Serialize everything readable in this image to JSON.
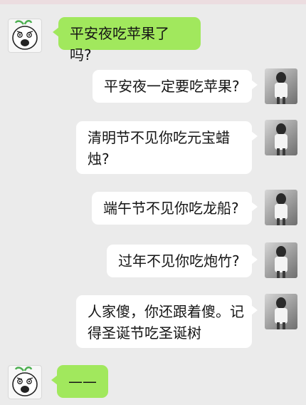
{
  "chat": {
    "messages": [
      {
        "side": "left",
        "text": "平安夜吃苹果了吗?"
      },
      {
        "side": "right",
        "text": "平安夜一定要吃苹果?"
      },
      {
        "side": "right",
        "line1": "清明节不见你吃元宝蜡",
        "line2": "烛?"
      },
      {
        "side": "right",
        "text": "端午节不见你吃龙船?"
      },
      {
        "side": "right",
        "text": "过年不见你吃炮竹?"
      },
      {
        "side": "right",
        "line1": "人家傻，你还跟着傻。记",
        "line2": "得圣诞节吃圣诞树"
      },
      {
        "side": "left",
        "text": "——"
      }
    ]
  },
  "colors": {
    "background": "#ebebeb",
    "sent_bubble": "#a1e85d",
    "received_bubble": "#ffffff"
  },
  "icons": {
    "left_avatar": "rage-face-avatar-icon",
    "right_avatar": "girl-photo-avatar-icon"
  }
}
